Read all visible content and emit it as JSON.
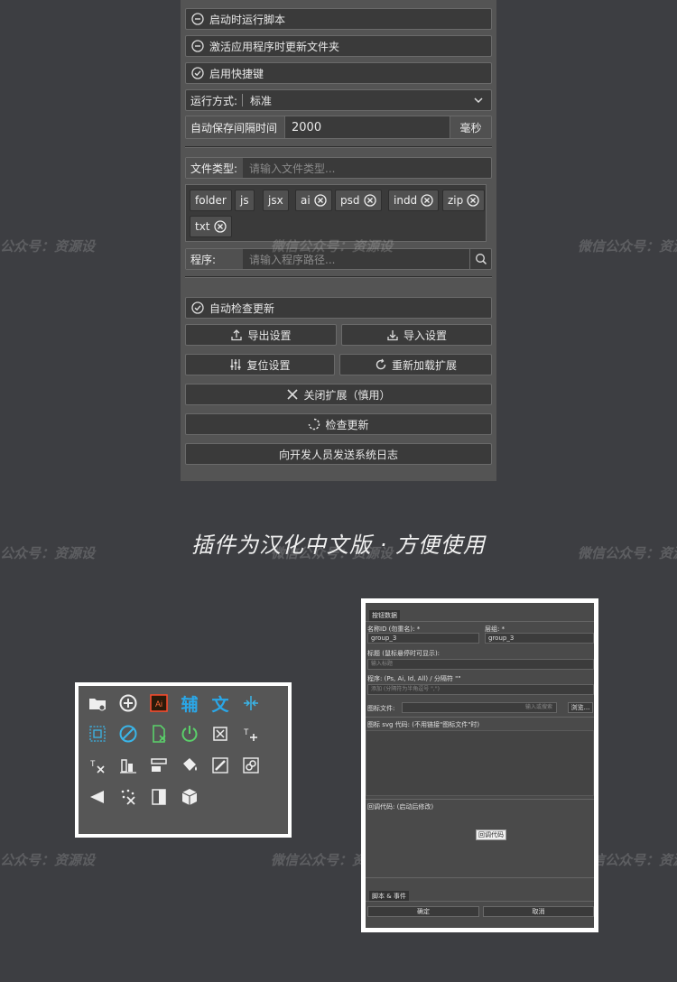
{
  "panel": {
    "toggles": [
      {
        "label": "启动时运行脚本",
        "state": "off"
      },
      {
        "label": "激活应用程序时更新文件夹",
        "state": "off"
      },
      {
        "label": "启用快捷键",
        "state": "on"
      }
    ],
    "run_mode": {
      "label": "运行方式:",
      "value": "标准"
    },
    "autosave": {
      "label": "自动保存间隔时间",
      "value": "2000",
      "unit": "毫秒"
    },
    "file_type": {
      "label": "文件类型:",
      "placeholder": "请输入文件类型..."
    },
    "tags": [
      "folder",
      "js",
      "jsx",
      "ai",
      "psd",
      "indd",
      "zip",
      "txt"
    ],
    "program": {
      "label": "程序:",
      "placeholder": "请输入程序路径..."
    },
    "auto_update": {
      "label": "自动检查更新",
      "state": "on"
    },
    "buttons": {
      "export": "导出设置",
      "import": "导入设置",
      "reset": "复位设置",
      "reload": "重新加载扩展",
      "close": "关闭扩展（慎用）",
      "check": "检查更新",
      "send_log": "向开发人员发送系统日志"
    }
  },
  "caption": "插件为汉化中文版 · 方便使用",
  "watermark": "微信公众号：资源设",
  "watermark_left": "公众号：资源设",
  "toolbar_icons": {
    "row1": [
      "folder-icon",
      "add-circle-icon",
      "illustrator-icon",
      "辅",
      "文",
      "align-center-icon"
    ],
    "row2": [
      "grid-select-icon",
      "no-icon",
      "file-remove-icon",
      "power-icon",
      "crop-icon",
      "text-add-icon"
    ],
    "row3": [
      "text-remove-icon",
      "bar-align-icon",
      "layout-icon",
      "paint-bucket-icon",
      "pen-icon",
      "link-icon"
    ],
    "row4": [
      "triangle-icon",
      "scatter-remove-icon",
      "half-rect-icon",
      "cube-icon"
    ],
    "ai_label": "Ai"
  },
  "dialog": {
    "section1": "按钮数据",
    "name_label": "名称ID (勿重名): *",
    "name_value": "group_3",
    "group_label": "层组: *",
    "group_value": "group_3",
    "title_label": "标题 (鼠标悬停时可显示):",
    "title_placeholder": "输入标题",
    "program_label": "程序: (Ps, Ai, Id, All) / 分隔符 \"\"",
    "program_placeholder": "添加 (分隔符为半角逗号 \",\")",
    "icon_file_label": "图标文件:",
    "icon_file_placeholder": "输入或搜索",
    "browse": "浏览...",
    "svg_label": "图标 svg 代码: (不用链接\"图标文件\"时)",
    "callback_label": "回调代码: (启动后修改)",
    "callback_btn": "回调代码",
    "section2": "脚本 & 事件",
    "ok": "确定",
    "cancel": "取消"
  }
}
